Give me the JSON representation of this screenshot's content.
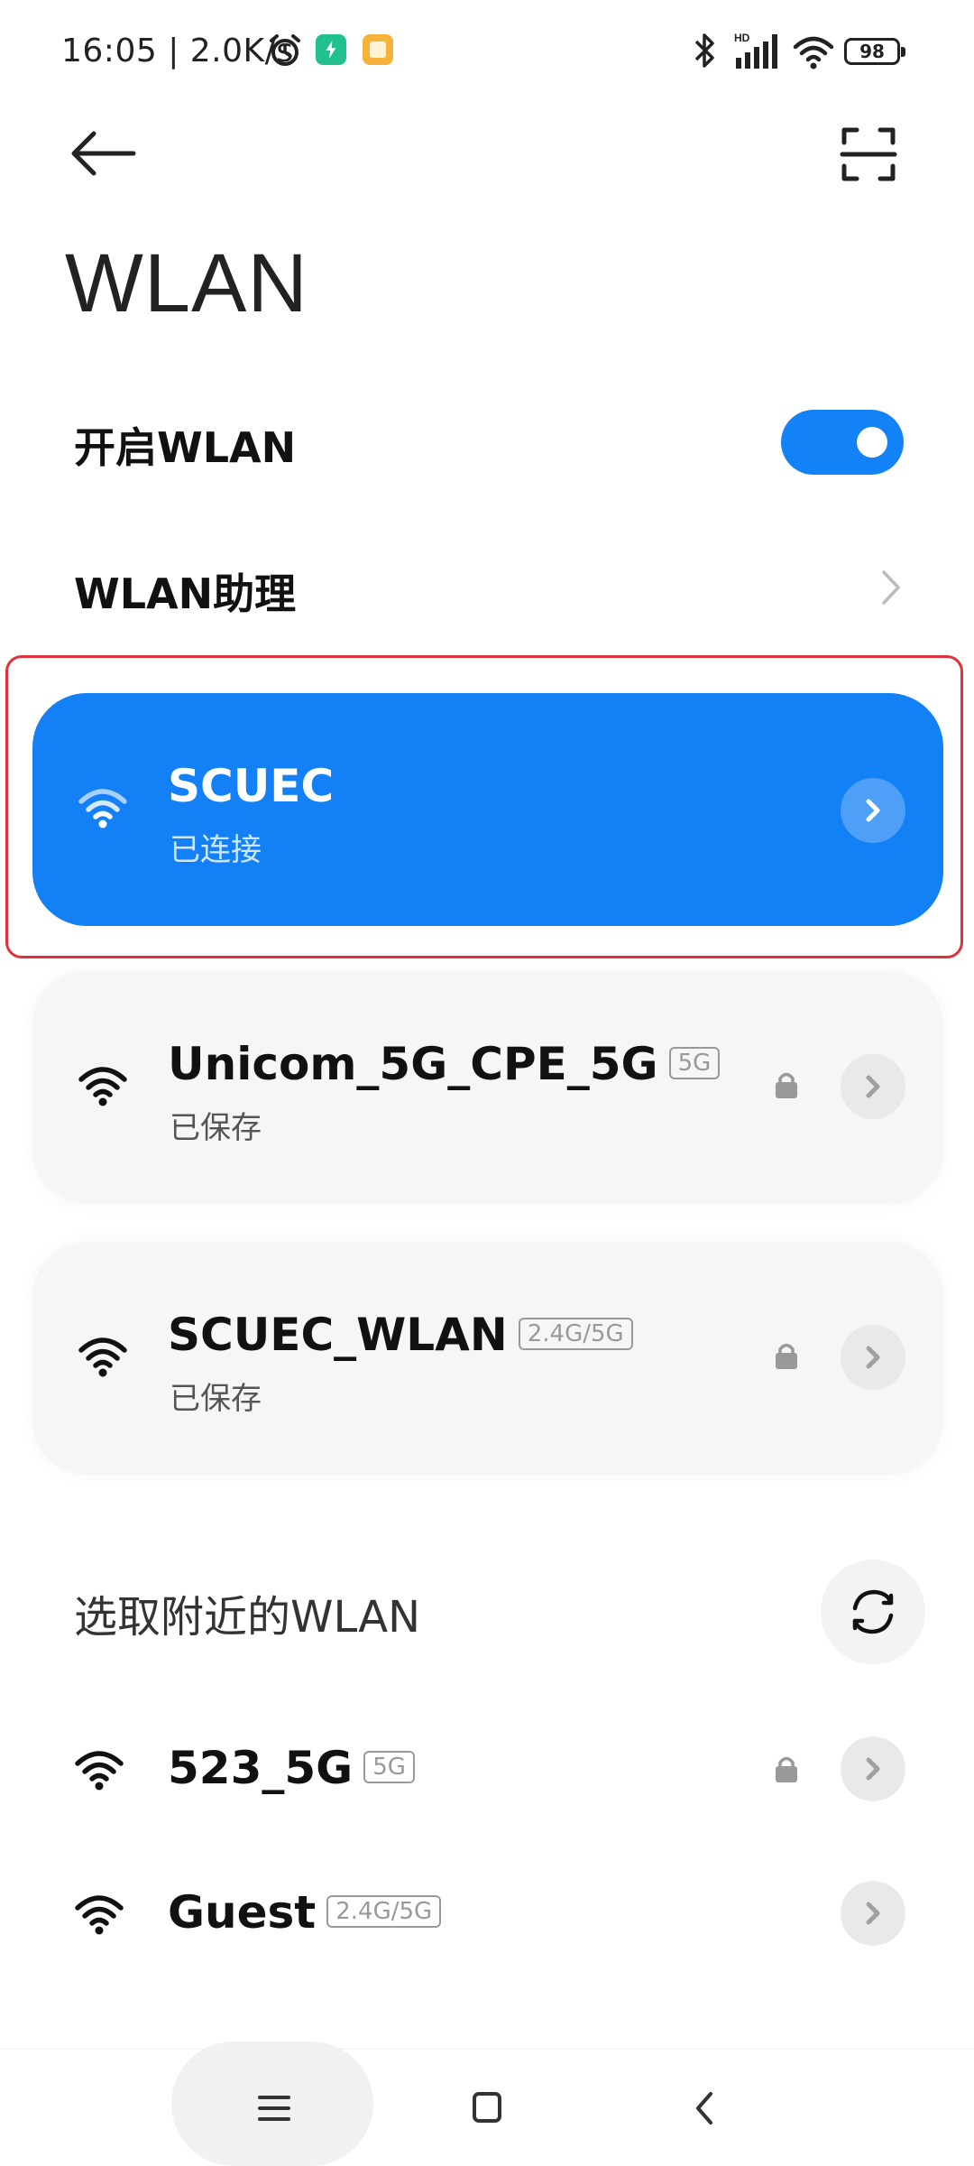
{
  "status_bar": {
    "time": "16:05 | 2.0K/s",
    "battery": "98"
  },
  "header": {
    "title": "WLAN"
  },
  "settings": {
    "enable_wlan_label": "开启WLAN",
    "wlan_enabled": true,
    "assistant_label": "WLAN助理"
  },
  "connected_network": {
    "name": "SCUEC",
    "status": "已连接"
  },
  "saved_networks": [
    {
      "name": "Unicom_5G_CPE_5G",
      "band": "5G",
      "status": "已保存",
      "locked": true
    },
    {
      "name": "SCUEC_WLAN",
      "band": "2.4G/5G",
      "status": "已保存",
      "locked": true
    }
  ],
  "nearby": {
    "section_title": "选取附近的WLAN",
    "networks": [
      {
        "name": "523_5G",
        "band": "5G",
        "locked": true
      },
      {
        "name": "Guest",
        "band": "2.4G/5G",
        "locked": false
      }
    ]
  },
  "colors": {
    "accent": "#1482f7",
    "highlight_frame": "#e0303a",
    "card_background": "#f6f6f6"
  }
}
